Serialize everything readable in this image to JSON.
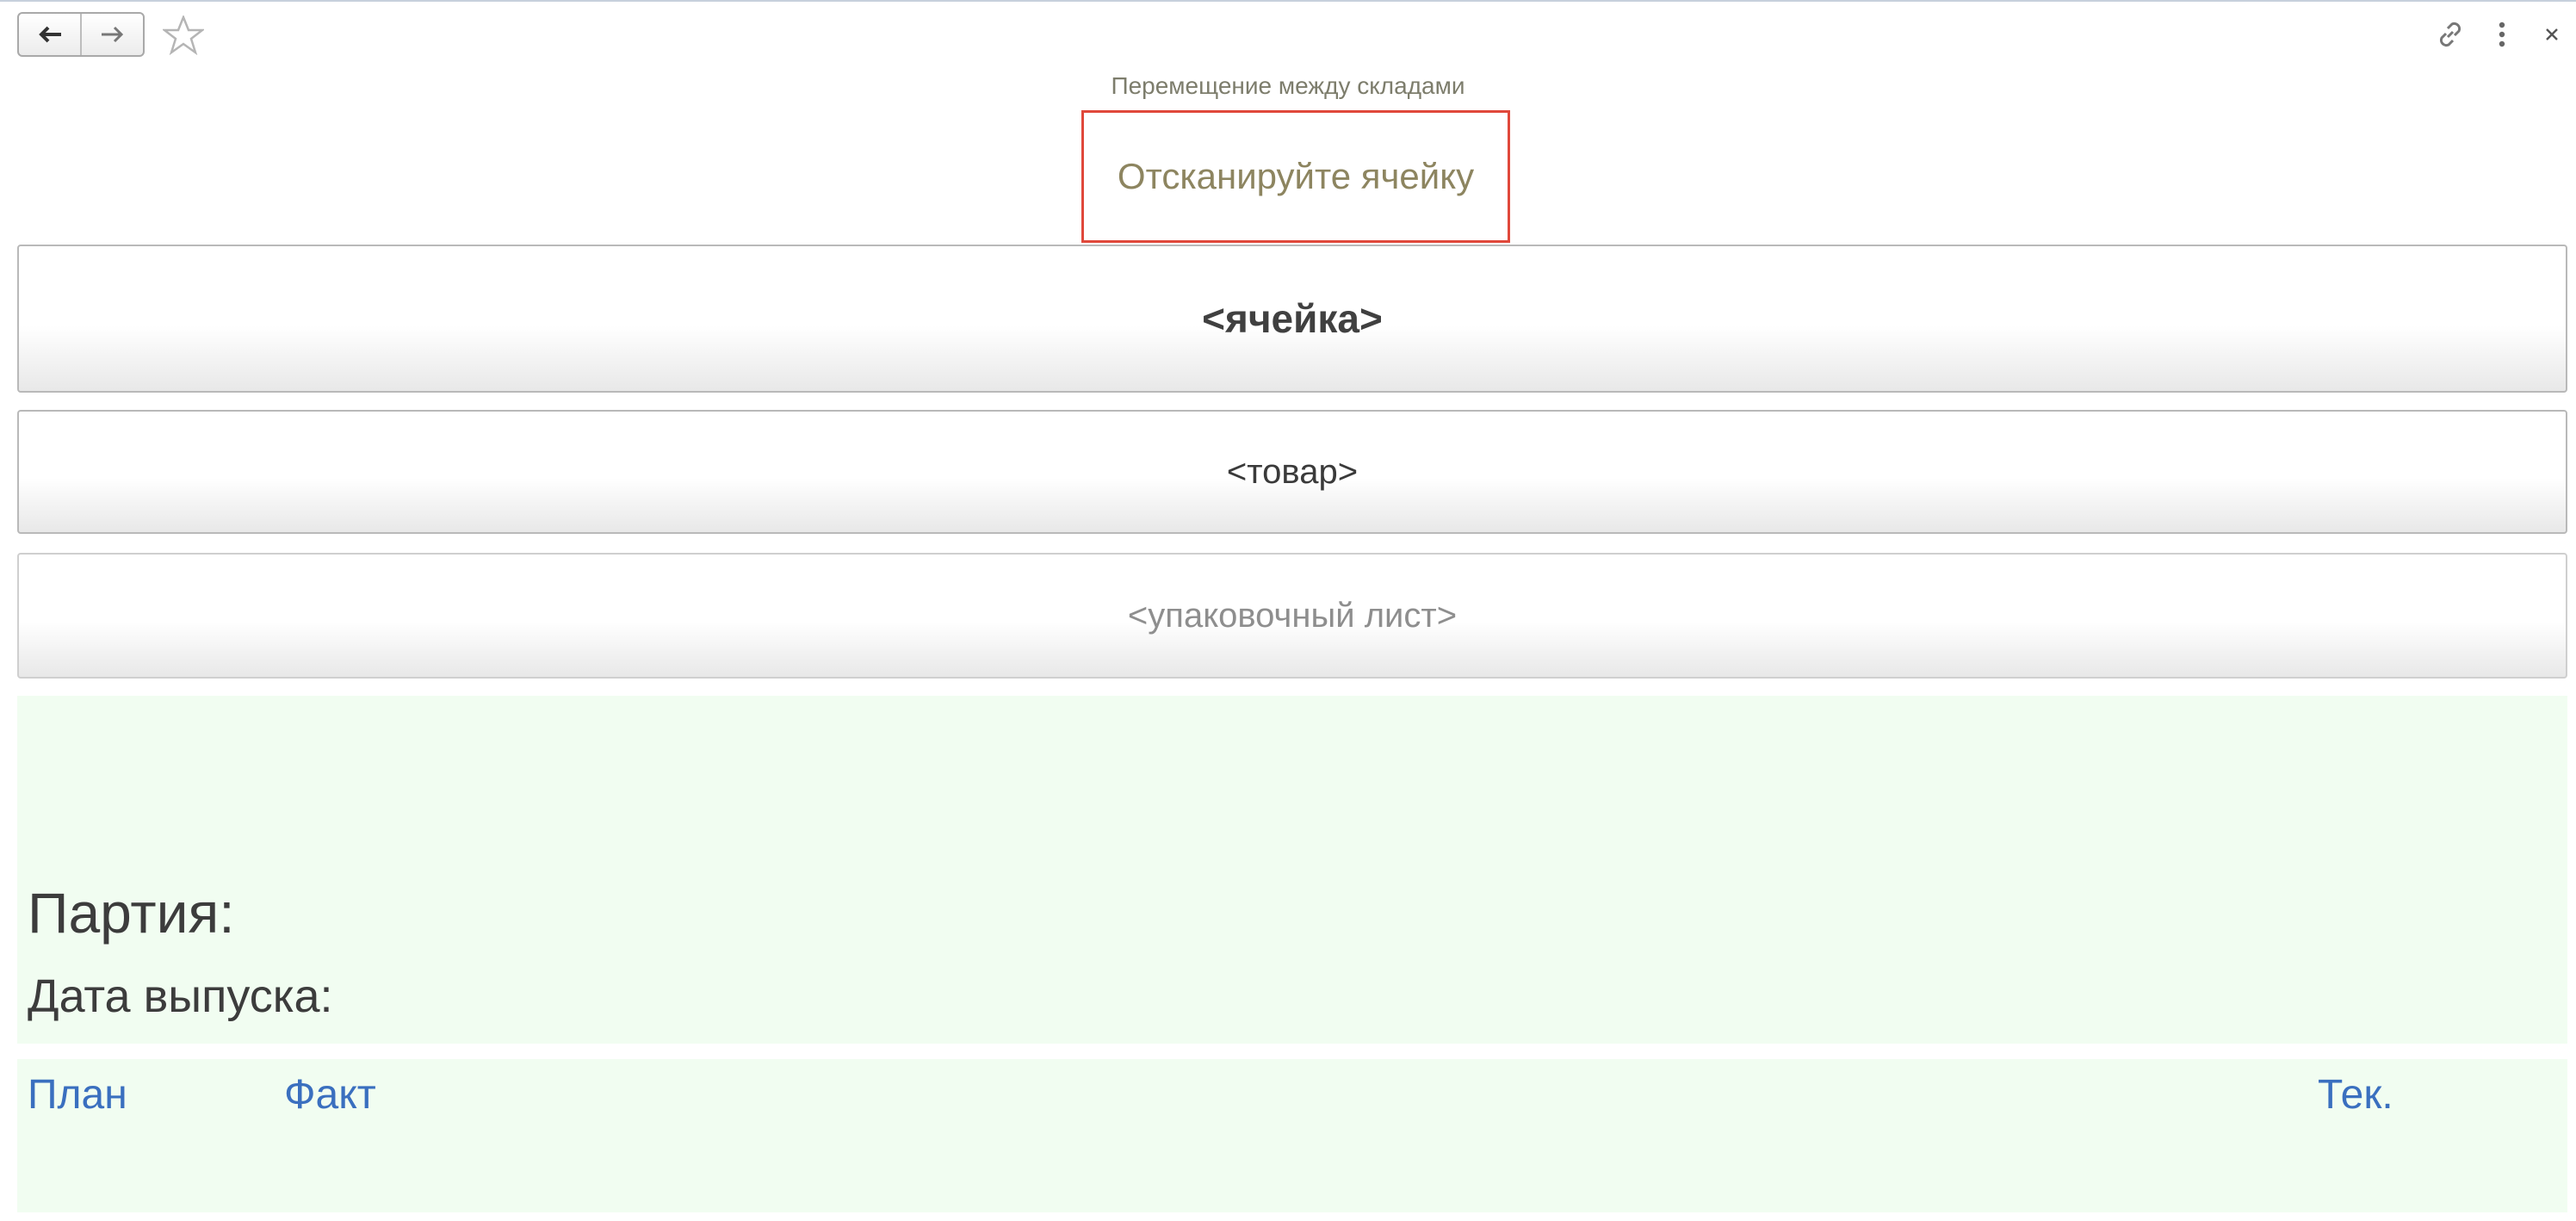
{
  "toolbar": {
    "back_icon": "arrow-left-icon",
    "forward_icon": "arrow-right-icon",
    "favorite_icon": "star-icon",
    "link_icon": "link-icon",
    "more_icon": "more-vertical-icon",
    "close_icon": "close-icon"
  },
  "header": {
    "subtitle": "Перемещение между складами",
    "prompt": "Отсканируйте ячейку"
  },
  "scan_fields": {
    "cell": "<ячейка>",
    "goods": "<товар>",
    "packing_list": "<упаковочный лист>"
  },
  "info": {
    "party_label": "Партия:",
    "release_date_label": "Дата выпуска:"
  },
  "quantities": {
    "plan_label": "План",
    "fact_label": "Факт",
    "current_label": "Тек."
  },
  "colors": {
    "prompt_border": "#e0483b",
    "panel_background": "#f1fdf1",
    "link_blue": "#3a6fbf"
  }
}
